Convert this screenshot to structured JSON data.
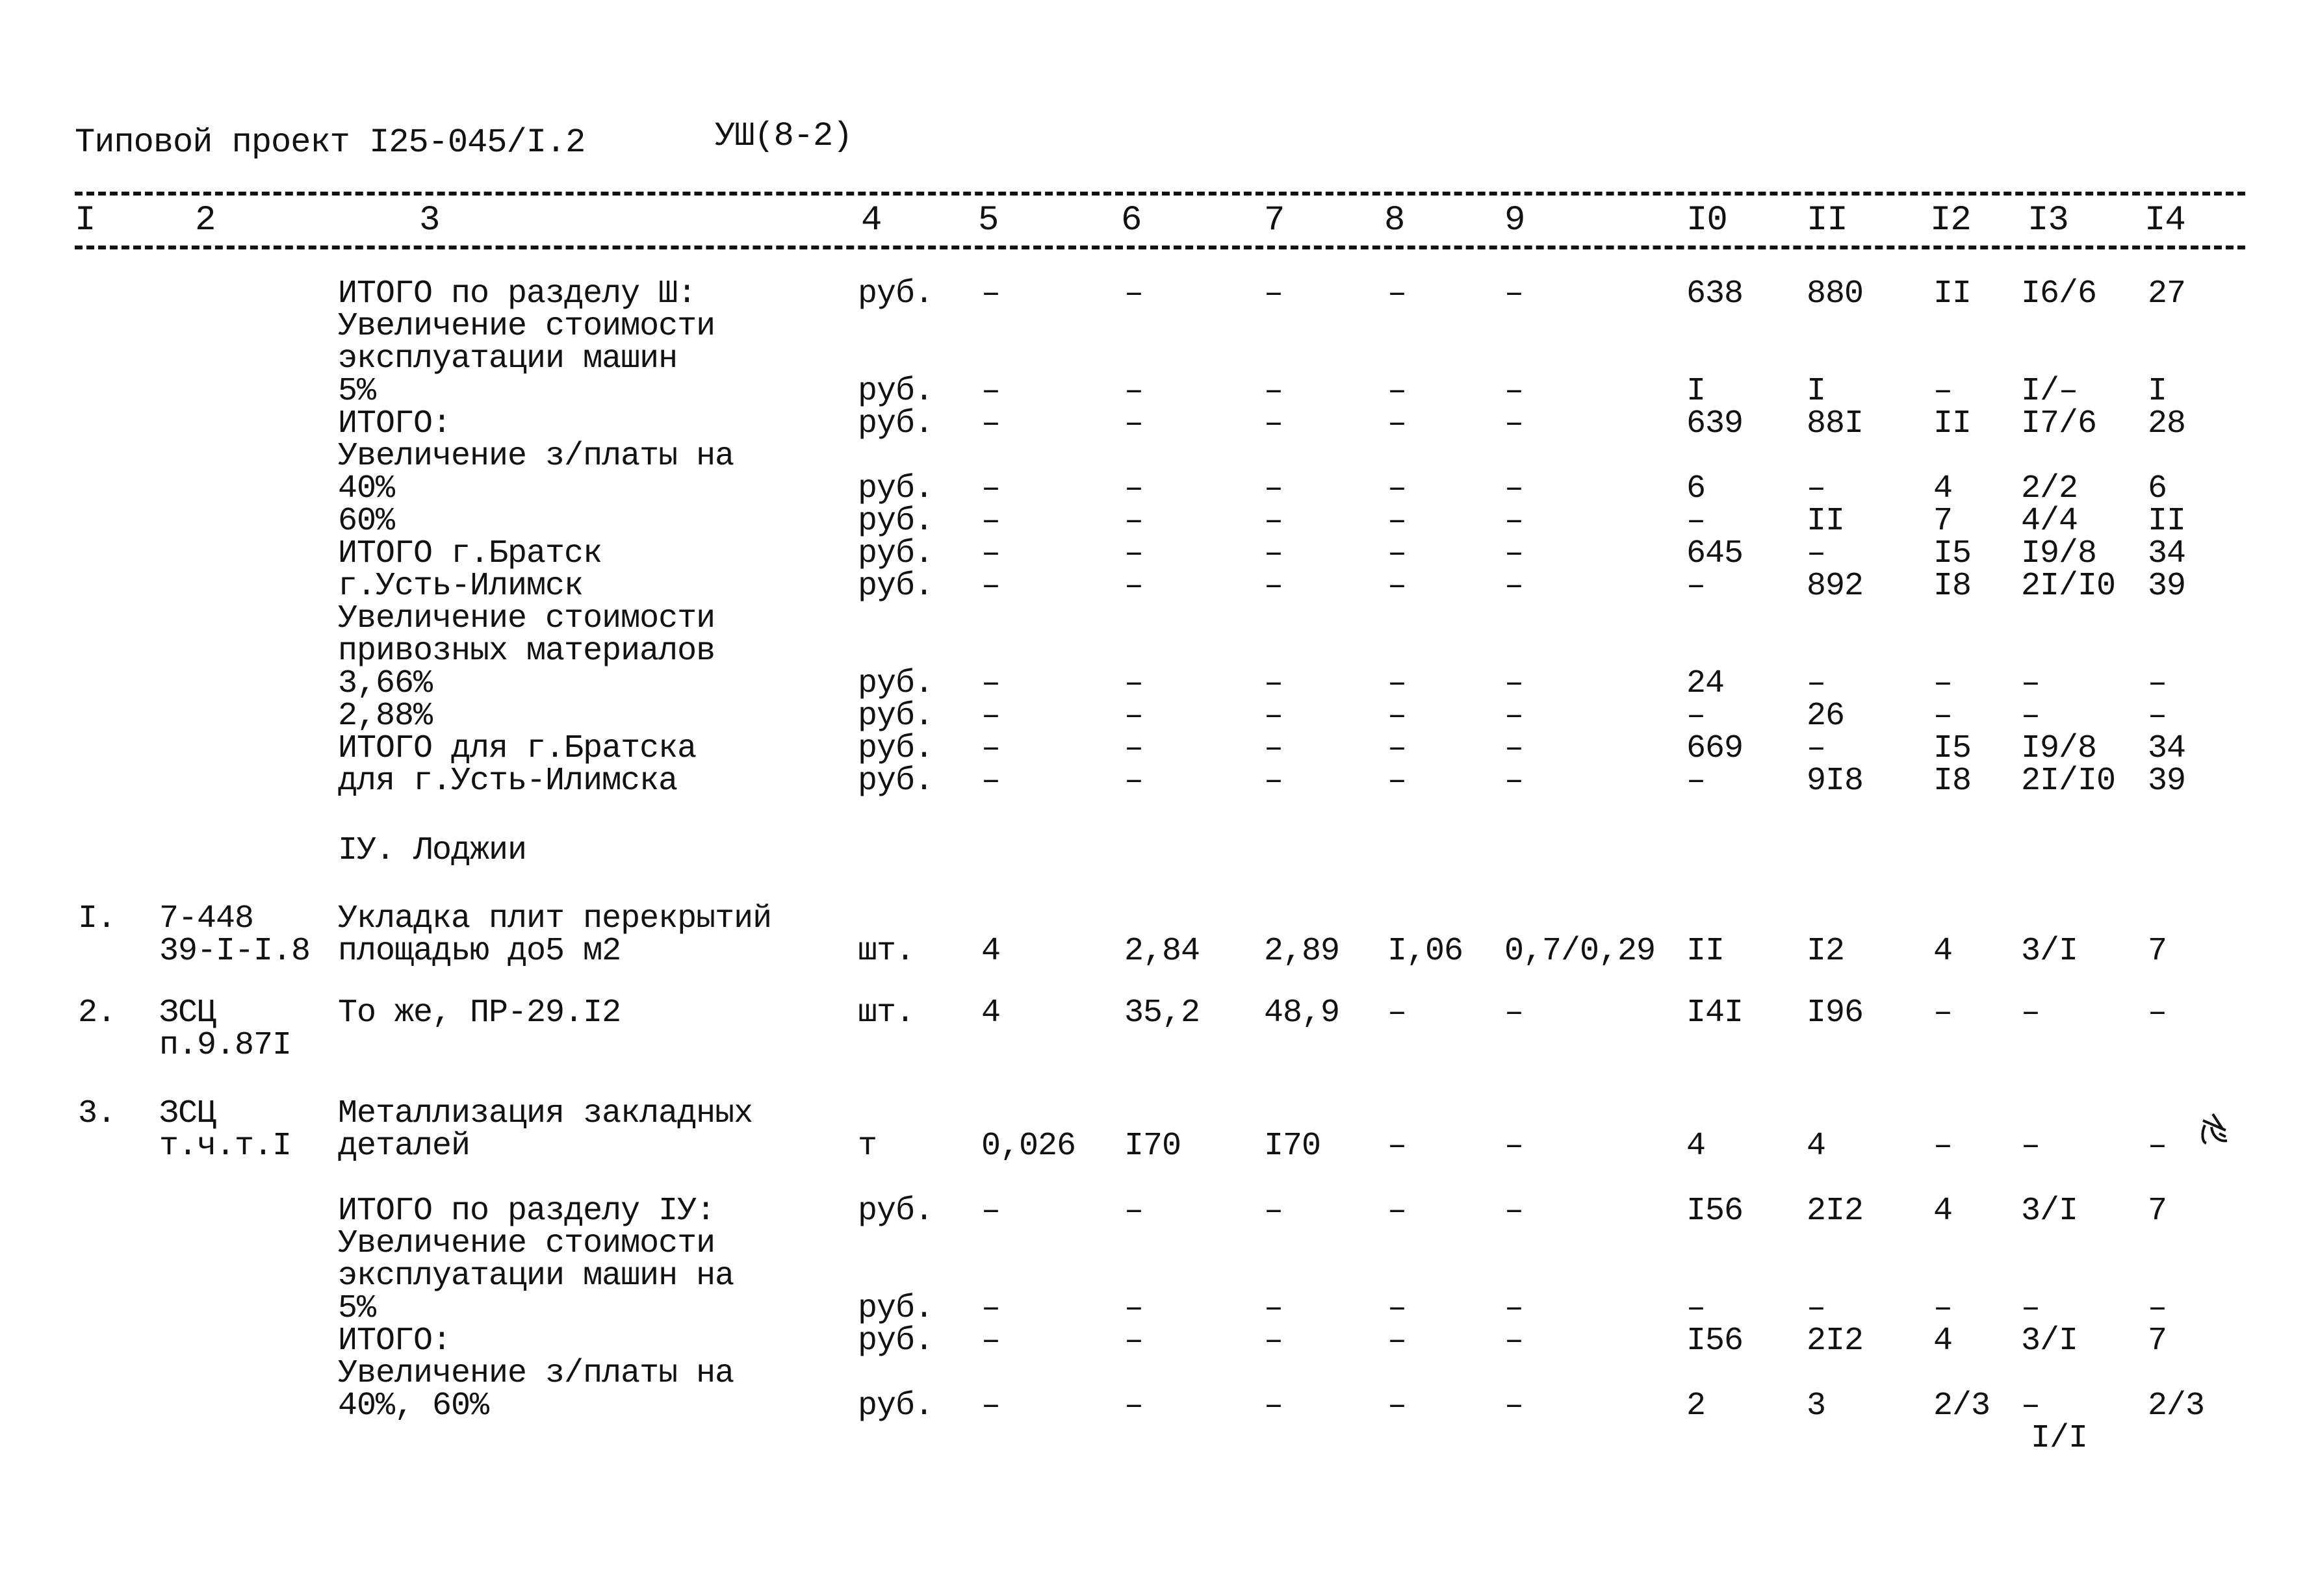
{
  "header": {
    "title": "Типовой проект I25-045/I.2",
    "sheet_code": "УШ(8-2)"
  },
  "columns": [
    "I",
    "2",
    "3",
    "4",
    "5",
    "6",
    "7",
    "8",
    "9",
    "I0",
    "II",
    "I2",
    "I3",
    "I4"
  ],
  "rows": [
    {
      "num": "",
      "code": "",
      "desc": [
        "ИТОГО по разделу Ш:"
      ],
      "unit": "руб.",
      "c5": "–",
      "c6": "–",
      "c7": "–",
      "c8": "–",
      "c9": "–",
      "c10": "638",
      "c11": "880",
      "c12": "II",
      "c13": "I6/6",
      "c14": "27"
    },
    {
      "num": "",
      "code": "",
      "desc": [
        "Увеличение стоимости",
        "эксплуатации машин"
      ],
      "unit": "",
      "c5": "",
      "c6": "",
      "c7": "",
      "c8": "",
      "c9": "",
      "c10": "",
      "c11": "",
      "c12": "",
      "c13": "",
      "c14": ""
    },
    {
      "num": "",
      "code": "",
      "desc": [
        "5%"
      ],
      "unit": "руб.",
      "c5": "–",
      "c6": "–",
      "c7": "–",
      "c8": "–",
      "c9": "–",
      "c10": "I",
      "c11": "I",
      "c12": "–",
      "c13": "I/–",
      "c14": "I"
    },
    {
      "num": "",
      "code": "",
      "desc": [
        "ИТОГО:"
      ],
      "unit": "руб.",
      "c5": "–",
      "c6": "–",
      "c7": "–",
      "c8": "–",
      "c9": "–",
      "c10": "639",
      "c11": "88I",
      "c12": "II",
      "c13": "I7/6",
      "c14": "28"
    },
    {
      "num": "",
      "code": "",
      "desc": [
        "Увеличение з/платы на"
      ],
      "unit": "",
      "c5": "",
      "c6": "",
      "c7": "",
      "c8": "",
      "c9": "",
      "c10": "",
      "c11": "",
      "c12": "",
      "c13": "",
      "c14": ""
    },
    {
      "num": "",
      "code": "",
      "desc": [
        "40%"
      ],
      "unit": "руб.",
      "c5": "–",
      "c6": "–",
      "c7": "–",
      "c8": "–",
      "c9": "–",
      "c10": "6",
      "c11": "–",
      "c12": "4",
      "c13": "2/2",
      "c14": "6"
    },
    {
      "num": "",
      "code": "",
      "desc": [
        "60%"
      ],
      "unit": "руб.",
      "c5": "–",
      "c6": "–",
      "c7": "–",
      "c8": "–",
      "c9": "–",
      "c10": "–",
      "c11": "II",
      "c12": "7",
      "c13": "4/4",
      "c14": "II"
    },
    {
      "num": "",
      "code": "",
      "desc": [
        "ИТОГО г.Братск"
      ],
      "unit": "руб.",
      "c5": "–",
      "c6": "–",
      "c7": "–",
      "c8": "–",
      "c9": "–",
      "c10": "645",
      "c11": "–",
      "c12": "I5",
      "c13": "I9/8",
      "c14": "34"
    },
    {
      "num": "",
      "code": "",
      "desc": [
        "г.Усть-Илимск"
      ],
      "unit": "руб.",
      "c5": "–",
      "c6": "–",
      "c7": "–",
      "c8": "–",
      "c9": "–",
      "c10": "–",
      "c11": "892",
      "c12": "I8",
      "c13": "2I/I0",
      "c14": "39"
    },
    {
      "num": "",
      "code": "",
      "desc": [
        "Увеличение стоимости",
        "привозных материалов"
      ],
      "unit": "",
      "c5": "",
      "c6": "",
      "c7": "",
      "c8": "",
      "c9": "",
      "c10": "",
      "c11": "",
      "c12": "",
      "c13": "",
      "c14": ""
    },
    {
      "num": "",
      "code": "",
      "desc": [
        "3,66%"
      ],
      "unit": "руб.",
      "c5": "–",
      "c6": "–",
      "c7": "–",
      "c8": "–",
      "c9": "–",
      "c10": "24",
      "c11": "–",
      "c12": "–",
      "c13": "–",
      "c14": "–"
    },
    {
      "num": "",
      "code": "",
      "desc": [
        "2,88%"
      ],
      "unit": "руб.",
      "c5": "–",
      "c6": "–",
      "c7": "–",
      "c8": "–",
      "c9": "–",
      "c10": "–",
      "c11": "26",
      "c12": "–",
      "c13": "–",
      "c14": "–"
    },
    {
      "num": "",
      "code": "",
      "desc": [
        "ИТОГО для г.Братска"
      ],
      "unit": "руб.",
      "c5": "–",
      "c6": "–",
      "c7": "–",
      "c8": "–",
      "c9": "–",
      "c10": "669",
      "c11": "–",
      "c12": "I5",
      "c13": "I9/8",
      "c14": "34"
    },
    {
      "num": "",
      "code": "",
      "desc": [
        "для г.Усть-Илимска"
      ],
      "unit": "руб.",
      "c5": "–",
      "c6": "–",
      "c7": "–",
      "c8": "–",
      "c9": "–",
      "c10": "–",
      "c11": "9I8",
      "c12": "I8",
      "c13": "2I/I0",
      "c14": "39"
    },
    {
      "num": "",
      "code": "",
      "desc": [
        "IУ. Лоджии"
      ],
      "unit": "",
      "c5": "",
      "c6": "",
      "c7": "",
      "c8": "",
      "c9": "",
      "c10": "",
      "c11": "",
      "c12": "",
      "c13": "",
      "c14": ""
    },
    {
      "num": "I.",
      "code": [
        "7-448",
        "39-I-I.8"
      ],
      "desc": [
        "Укладка плит перекрытий",
        "площадью до5 м2"
      ],
      "unit": "шт.",
      "c5": "4",
      "c6": "2,84",
      "c7": "2,89",
      "c8": "I,06",
      "c9": "0,7/0,29",
      "c10": "II",
      "c11": "I2",
      "c12": "4",
      "c13": "3/I",
      "c14": "7"
    },
    {
      "num": "2.",
      "code": [
        "ЗСЦ",
        "п.9.87I"
      ],
      "desc": [
        "То же, ПР-29.I2"
      ],
      "unit": "шт.",
      "c5": "4",
      "c6": "35,2",
      "c7": "48,9",
      "c8": "–",
      "c9": "–",
      "c10": "I4I",
      "c11": "I96",
      "c12": "–",
      "c13": "–",
      "c14": "–"
    },
    {
      "num": "3.",
      "code": [
        "ЗСЦ",
        "т.ч.т.I"
      ],
      "desc": [
        "Металлизация закладных",
        "деталей"
      ],
      "unit": "т",
      "c5": "0,026",
      "c6": "I70",
      "c7": "I70",
      "c8": "–",
      "c9": "–",
      "c10": "4",
      "c11": "4",
      "c12": "–",
      "c13": "–",
      "c14": "–"
    },
    {
      "num": "",
      "code": "",
      "desc": [
        "ИТОГО по разделу IУ:"
      ],
      "unit": "руб.",
      "c5": "–",
      "c6": "–",
      "c7": "–",
      "c8": "–",
      "c9": "–",
      "c10": "I56",
      "c11": "2I2",
      "c12": "4",
      "c13": "3/I",
      "c14": "7"
    },
    {
      "num": "",
      "code": "",
      "desc": [
        "Увеличение стоимости",
        "эксплуатации машин на"
      ],
      "unit": "",
      "c5": "",
      "c6": "",
      "c7": "",
      "c8": "",
      "c9": "",
      "c10": "",
      "c11": "",
      "c12": "",
      "c13": "",
      "c14": ""
    },
    {
      "num": "",
      "code": "",
      "desc": [
        "5%"
      ],
      "unit": "руб.",
      "c5": "–",
      "c6": "–",
      "c7": "–",
      "c8": "–",
      "c9": "–",
      "c10": "–",
      "c11": "–",
      "c12": "–",
      "c13": "–",
      "c14": "–"
    },
    {
      "num": "",
      "code": "",
      "desc": [
        "ИТОГО:"
      ],
      "unit": "руб.",
      "c5": "–",
      "c6": "–",
      "c7": "–",
      "c8": "–",
      "c9": "–",
      "c10": "I56",
      "c11": "2I2",
      "c12": "4",
      "c13": "3/I",
      "c14": "7"
    },
    {
      "num": "",
      "code": "",
      "desc": [
        "Увеличение з/платы на"
      ],
      "unit": "",
      "c5": "",
      "c6": "",
      "c7": "",
      "c8": "",
      "c9": "",
      "c10": "",
      "c11": "",
      "c12": "",
      "c13": "",
      "c14": ""
    },
    {
      "num": "",
      "code": "",
      "desc": [
        "40%, 60%"
      ],
      "unit": "руб.",
      "c5": "–",
      "c6": "–",
      "c7": "–",
      "c8": "–",
      "c9": "–",
      "c10": "2",
      "c11": "3",
      "c12": "2/3",
      "c13": "–",
      "c14": "2/3"
    }
  ],
  "extra_notes": {
    "col13_last_row_sub": "I/I",
    "handwritten_mark": "handwritten initials"
  }
}
